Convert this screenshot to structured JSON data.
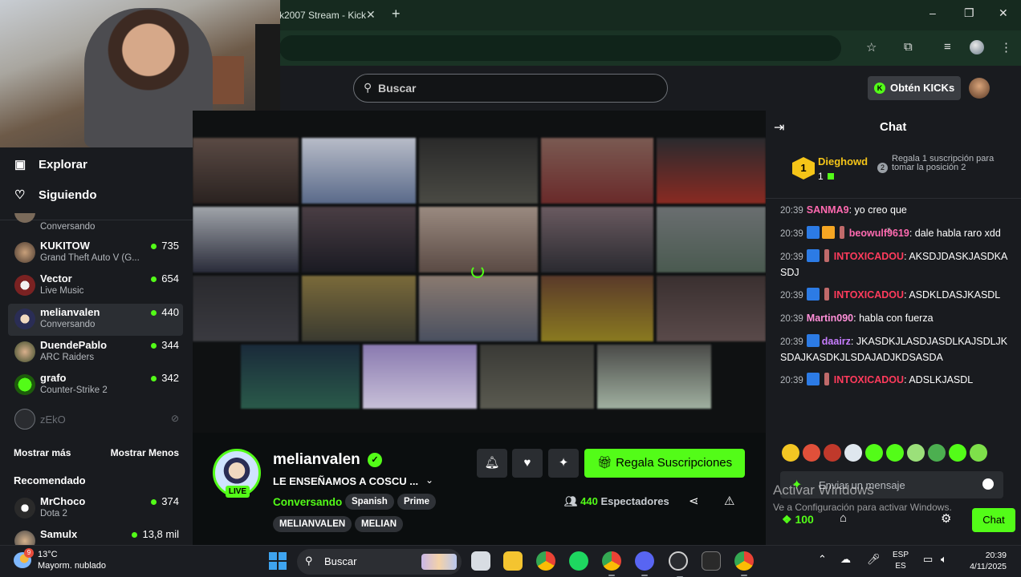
{
  "browser": {
    "tab_title": "k2007 Stream - Kick",
    "new_tab_symbol": "+",
    "tab_close_symbol": "✕",
    "window_controls": [
      "–",
      "❐",
      "✕"
    ]
  },
  "header": {
    "search_placeholder": "Buscar",
    "kicks_button": "Obtén KICKs",
    "kicks_icon": "K"
  },
  "sidebar": {
    "nav": [
      {
        "icon": "compass-icon",
        "label": "Explorar"
      },
      {
        "icon": "heart-icon",
        "label": "Siguiendo"
      }
    ],
    "following": [
      {
        "name": "",
        "category": "Conversando",
        "viewers": ""
      },
      {
        "name": "KUKITOW",
        "category": "Grand Theft Auto V (G...",
        "viewers": "735"
      },
      {
        "name": "Vector",
        "category": "Live Music",
        "viewers": "654"
      },
      {
        "name": "melianvalen",
        "category": "Conversando",
        "viewers": "440"
      },
      {
        "name": "DuendePablo",
        "category": "ARC Raiders",
        "viewers": "344"
      },
      {
        "name": "grafo",
        "category": "Counter-Strike 2",
        "viewers": "342"
      },
      {
        "name": "zEkO",
        "category": "",
        "viewers": ""
      }
    ],
    "show_more": "Mostrar más",
    "show_less": "Mostrar Menos",
    "recommended_title": "Recomendado",
    "recommended": [
      {
        "name": "MrChoco",
        "category": "Dota 2",
        "viewers": "374"
      },
      {
        "name": "Samulx",
        "category": "",
        "viewers": "13,8 mil"
      }
    ]
  },
  "stream": {
    "channel": "melianvalen",
    "live_label": "LIVE",
    "title": "LE ENSEÑAMOS A COSCU ...",
    "category": "Conversando",
    "tags_row1": [
      "Spanish",
      "Prime"
    ],
    "tags_row2": [
      "MELIANVALEN",
      "MELIAN"
    ],
    "gift_button": "Regala Suscripciones",
    "viewer_count": "440",
    "viewer_label": "Espectadores"
  },
  "chat": {
    "title": "Chat",
    "pinned": {
      "rank": "1",
      "user": "Dieghowd",
      "count": "1",
      "next_rank": "2",
      "message": "Regala 1 suscripción para tomar la posición 2"
    },
    "messages": [
      {
        "time": "20:39",
        "user": "SANMA9",
        "color": "#ff6ab0",
        "badges": [],
        "text": "yo creo que"
      },
      {
        "time": "20:39",
        "user": "beowulf9619",
        "color": "#ff6ab0",
        "badges": [
          "blue",
          "crown",
          "slim"
        ],
        "text": "dale habla raro xdd"
      },
      {
        "time": "20:39",
        "user": "INTOXICADOU",
        "color": "#ff3b5c",
        "badges": [
          "blue",
          "slim"
        ],
        "text": "AKSDJDASKJASDKASDJ"
      },
      {
        "time": "20:39",
        "user": "INTOXICADOU",
        "color": "#ff3b5c",
        "badges": [
          "blue",
          "slim"
        ],
        "text": "ASDKLDASJKASDL"
      },
      {
        "time": "20:39",
        "user": "Martin090",
        "color": "#ff8fd8",
        "badges": [],
        "text": "habla con fuerza"
      },
      {
        "time": "20:39",
        "user": "daairz",
        "color": "#c77dff",
        "badges": [
          "blue"
        ],
        "text": "JKASDKJLASDJASDLKAJSDLJKSDAJKASDKJLSDAJADJKDSASDA"
      },
      {
        "time": "20:39",
        "user": "INTOXICADOU",
        "color": "#ff3b5c",
        "badges": [
          "blue",
          "slim"
        ],
        "text": "ADSLKJASDL"
      }
    ],
    "input_placeholder": "Enviar un mensaje",
    "points": "100",
    "chat_button": "Chat"
  },
  "watermark": {
    "line1": "Activar Windows",
    "line2": "Ve a Configuración para activar Windows."
  },
  "taskbar": {
    "temperature": "13°C",
    "forecast": "Mayorm. nublado",
    "weather_badge": "9",
    "search_label": "Buscar",
    "lang_top": "ESP",
    "lang_bottom": "ES",
    "time": "20:39",
    "date": "4/11/2025"
  },
  "colors": {
    "kick_green": "#53fc18",
    "panel": "#191b1f",
    "background": "#0b0e0f"
  }
}
